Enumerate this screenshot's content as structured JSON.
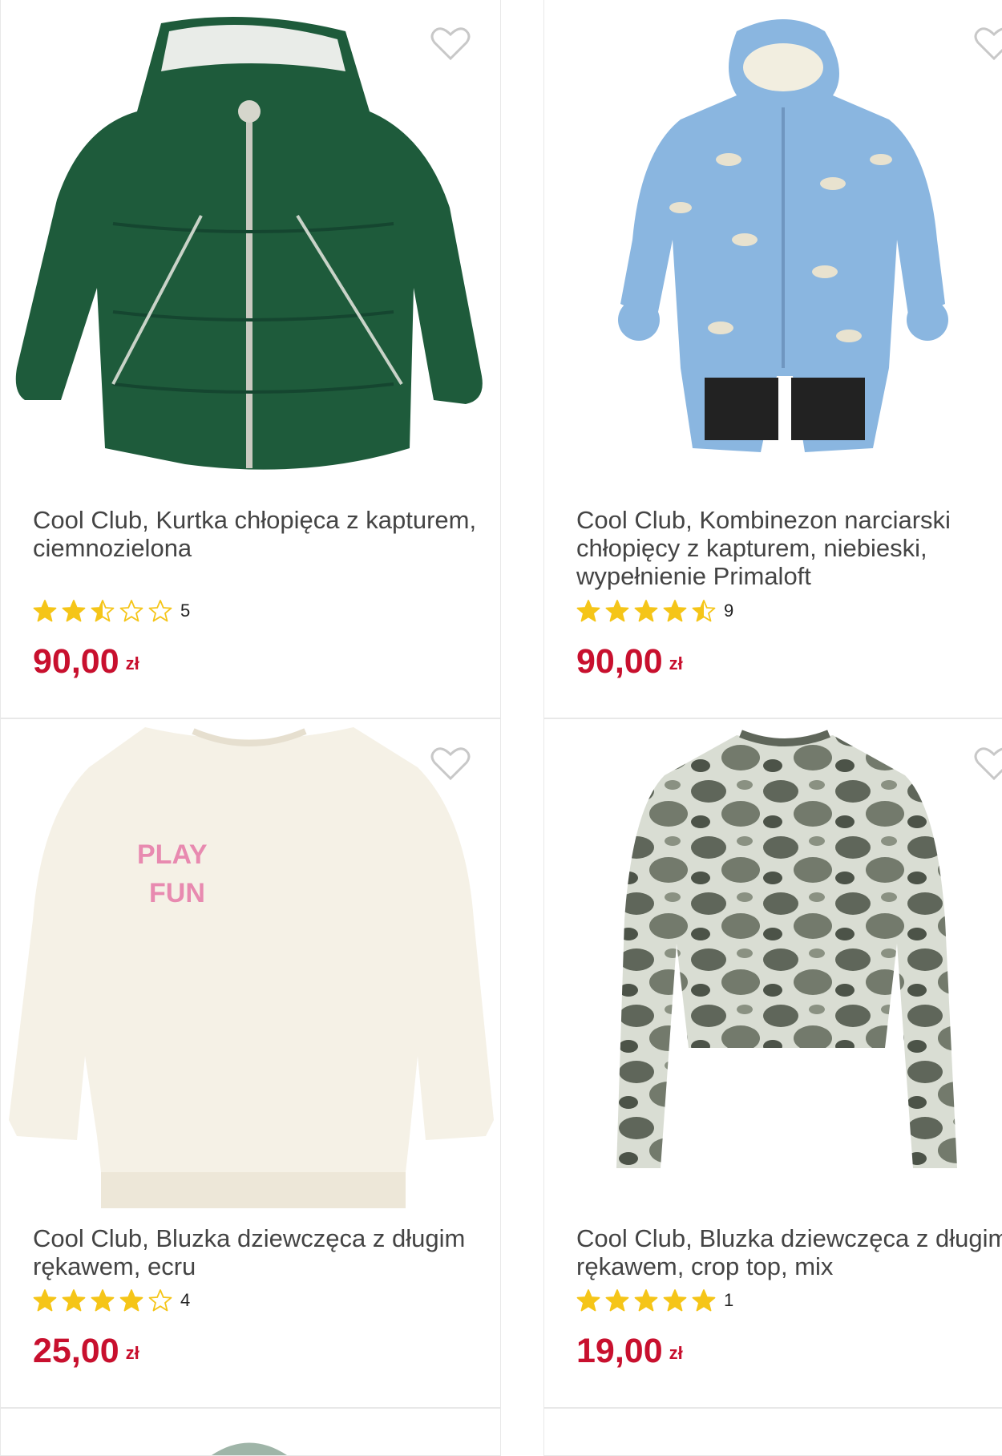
{
  "products": [
    {
      "title": "Cool Club, Kurtka chłopięca z kapturem, ciemnozielona",
      "rating": 2.5,
      "reviews": "5",
      "price": "90,00",
      "currency": "zł"
    },
    {
      "title": "Cool Club, Kombinezon narciarski chłopięcy z kapturem, niebieski, wypełnienie Primaloft",
      "rating": 4.5,
      "reviews": "9",
      "price": "90,00",
      "currency": "zł"
    },
    {
      "title": "Cool Club, Bluzka dziewczęca z długim rękawem, ecru",
      "rating": 4,
      "reviews": "4",
      "price": "25,00",
      "currency": "zł"
    },
    {
      "title": "Cool Club, Bluzka dziewczęca z długim rękawem, crop top, mix",
      "rating": 5,
      "reviews": "1",
      "price": "19,00",
      "currency": "zł"
    }
  ],
  "colors": {
    "price": "#c8102e",
    "star": "#f5c518",
    "jacket": "#1e5b3b",
    "snowsuit": "#8ab6e0",
    "sweatshirt": "#f5f1e6",
    "tiedye": "#6d7266"
  },
  "icons": {
    "favorite": "heart-outline-icon",
    "rating": "star-icon"
  }
}
